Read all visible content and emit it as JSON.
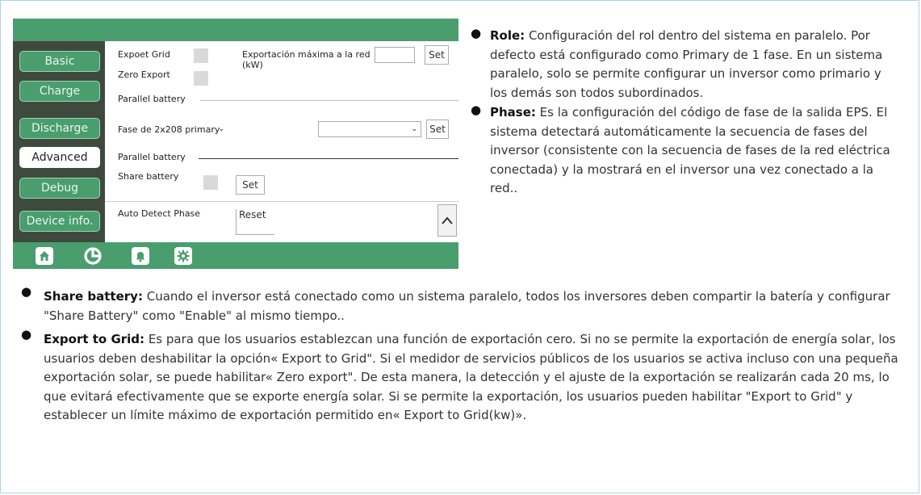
{
  "sidebar": {
    "items": [
      {
        "label": "Basic",
        "active": false
      },
      {
        "label": "Charge",
        "active": false
      },
      {
        "label": "Discharge",
        "active": false
      },
      {
        "label": "Advanced",
        "active": true
      },
      {
        "label": "Debug",
        "active": false
      },
      {
        "label": "Device info.",
        "active": false
      }
    ]
  },
  "settings": {
    "export_grid_label": "Expoet Grid",
    "zero_export_label": "Zero Export",
    "max_export_label": "Exportación máxima a la red (kW)",
    "max_export_value": "",
    "set_label": "Set",
    "parallel_battery_label_1": "Parallel battery",
    "phase_label": "Fase de 2x208 primary",
    "phase_select_value": "",
    "second_select_value": "",
    "parallel_battery_label_2": "Parallel battery",
    "share_battery_label": "Share battery",
    "auto_detect_label": "Auto Detect Phase",
    "reset_label": "Reset"
  },
  "bottom_nav": {
    "icons": [
      "home-icon",
      "pie-chart-icon",
      "bell-icon",
      "gear-icon"
    ]
  },
  "notes_right": [
    {
      "term": "Role:",
      "text": " Configuración del rol dentro del sistema en paralelo. Por defecto está configurado como Primary de 1 fase. En un sistema paralelo, solo se permite configurar un inversor como primario y los demás son todos subordinados."
    },
    {
      "term": "Phase:",
      "text": " Es la configuración del código de fase de la salida EPS. El sistema detectará automáticamente la secuencia de fases del inversor (consistente con la secuencia de fases de la red eléctrica conectada) y la mostrará en el inversor una vez conectado a la red.."
    }
  ],
  "notes_bottom": [
    {
      "term": "Share battery:",
      "text": " Cuando el inversor está conectado como un sistema paralelo, todos los inversores deben compartir la batería y configurar \"Share Battery\" como \"Enable\" al mismo tiempo.."
    },
    {
      "term": "Export to Grid:",
      "text": " Es para que los usuarios establezcan una función de exportación cero. Si no se permite la exportación de energía solar, los usuarios deben deshabilitar la opción« Export to Grid\". Si el medidor de servicios públicos de los usuarios se activa incluso con una pequeña exportación solar, se puede habilitar« Zero export\". De esta manera, la detección y el ajuste de la exportación se realizarán cada 20 ms, lo que evitará efectivamente que se exporte energía solar. Si se permite la exportación, los usuarios pueden habilitar \"Export to Grid\" y establecer un límite máximo de exportación permitido en« Export to Grid(kw)»."
    }
  ]
}
